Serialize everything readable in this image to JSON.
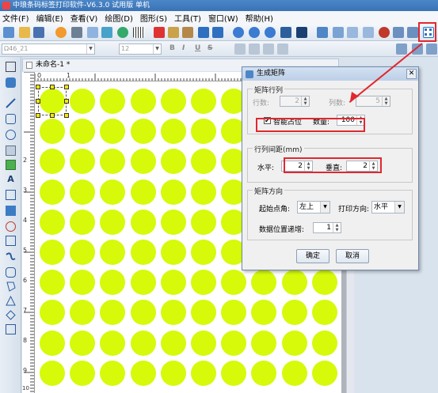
{
  "app": {
    "title": "中琅条码标签打印软件-V6.3.0 试用版 单机"
  },
  "menu": [
    "文件(F)",
    "编辑(E)",
    "查看(V)",
    "绘图(D)",
    "图形(S)",
    "工具(T)",
    "窗口(W)",
    "帮助(H)"
  ],
  "format_bar": {
    "font": "Ω46_21",
    "size": "12",
    "bold": "B",
    "italic": "I",
    "underline": "U",
    "strike": "S"
  },
  "document": {
    "tab_title": "未命名-1 *"
  },
  "ruler": {
    "top_labels": [
      "0",
      "1"
    ],
    "left_labels": [
      "2",
      "3",
      "4",
      "5",
      "6",
      "7",
      "8",
      "9",
      "10"
    ]
  },
  "dialog": {
    "title": "生成矩阵",
    "close": "✕",
    "section_rowcol": "矩阵行列",
    "rows_label": "行数:",
    "rows_value": "2",
    "cols_label": "列数:",
    "cols_value": "5",
    "smart_label": "智能占位",
    "smart_checked": "✔",
    "qty_label": "数量:",
    "qty_value": "100",
    "section_spacing": "行列间距(mm)",
    "h_label": "水平:",
    "h_value": "2",
    "v_label": "垂直:",
    "v_value": "2",
    "section_direction": "矩阵方向",
    "start_label": "起始点角:",
    "start_value": "左上",
    "print_dir_label": "打印方向:",
    "print_dir_value": "水平",
    "increment_label": "数据位置递增:",
    "increment_value": "1",
    "ok": "确定",
    "cancel": "取消"
  },
  "colors": {
    "circle": "#d6fa0a",
    "highlight": "#e0282e",
    "title_bar": "#3a73b5"
  }
}
